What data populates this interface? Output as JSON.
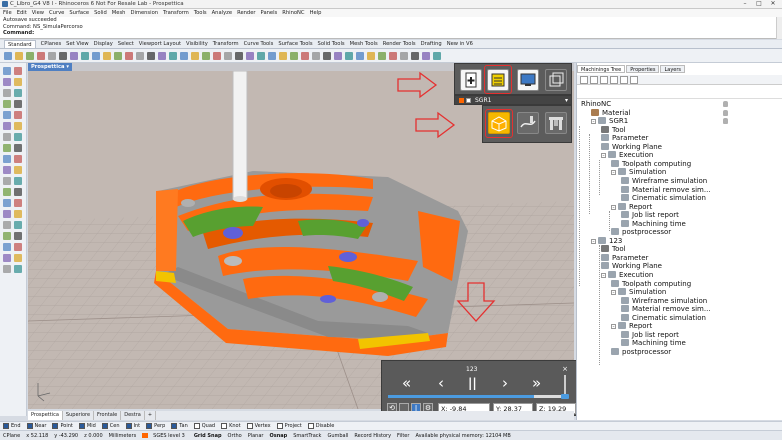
{
  "window": {
    "title": "C_Libro_G4 V8 l - Rhinoceros 6 Not For Resale Lab - Prospettica"
  },
  "menu": [
    "File",
    "Edit",
    "View",
    "Curve",
    "Surface",
    "Solid",
    "Mesh",
    "Dimension",
    "Transform",
    "Tools",
    "Analyze",
    "Render",
    "Panels",
    "RhinoNC",
    "Help"
  ],
  "command": {
    "lines": [
      "Autosave succeeded",
      "Command: NS_SimulaPercorso"
    ],
    "prompt": "Command:"
  },
  "toolbar_tabs": [
    "Standard",
    "CPlanes",
    "Set View",
    "Display",
    "Select",
    "Viewport Layout",
    "Visibility",
    "Transform",
    "Curve Tools",
    "Surface Tools",
    "Solid Tools",
    "Mesh Tools",
    "Render Tools",
    "Drafting",
    "New in V6"
  ],
  "viewport": {
    "title": "Prospettica",
    "tabs": [
      "Prospettica",
      "Superiore",
      "Frontale",
      "Destra",
      "+"
    ]
  },
  "plugin_panel": {
    "layer_name": "SGR1",
    "colors": {
      "orange": "#ff6600",
      "yellow": "#f0d000",
      "highlight": "#e53030"
    }
  },
  "player": {
    "step": "123",
    "close": "×",
    "controls": [
      "«",
      "‹",
      "||",
      "›",
      "»"
    ],
    "progress": 0.83,
    "coords": {
      "x": "X: -9.84",
      "y": "Y: 28.37",
      "z": "Z: 19.29"
    }
  },
  "right_panel": {
    "tabs": [
      "Machinings Tree",
      "Properties",
      "Layers"
    ],
    "tree": [
      {
        "label": "RhinoNC",
        "level": 0
      },
      {
        "label": "Material",
        "level": 1
      },
      {
        "label": "SGR1",
        "level": 1
      },
      {
        "label": "Tool",
        "level": 2
      },
      {
        "label": "Parameter",
        "level": 2
      },
      {
        "label": "Working Plane",
        "level": 2
      },
      {
        "label": "Execution",
        "level": 2
      },
      {
        "label": "Toolpath computing",
        "level": 3
      },
      {
        "label": "Simulation",
        "level": 3
      },
      {
        "label": "Wireframe simulation",
        "level": 4
      },
      {
        "label": "Material remove sim...",
        "level": 4
      },
      {
        "label": "Cinematic simulation",
        "level": 4
      },
      {
        "label": "Report",
        "level": 3
      },
      {
        "label": "Job list report",
        "level": 4
      },
      {
        "label": "Machining time",
        "level": 4
      },
      {
        "label": "postprocessor",
        "level": 3
      },
      {
        "label": "123",
        "level": 1
      },
      {
        "label": "Tool",
        "level": 2
      },
      {
        "label": "Parameter",
        "level": 2
      },
      {
        "label": "Working Plane",
        "level": 2
      },
      {
        "label": "Execution",
        "level": 2
      },
      {
        "label": "Toolpath computing",
        "level": 3
      },
      {
        "label": "Simulation",
        "level": 3
      },
      {
        "label": "Wireframe simulation",
        "level": 4
      },
      {
        "label": "Material remove sim...",
        "level": 4
      },
      {
        "label": "Cinematic simulation",
        "level": 4
      },
      {
        "label": "Report",
        "level": 3
      },
      {
        "label": "Job list report",
        "level": 4
      },
      {
        "label": "Machining time",
        "level": 4
      },
      {
        "label": "postprocessor",
        "level": 3
      }
    ]
  },
  "osnaps": [
    {
      "label": "End",
      "on": true
    },
    {
      "label": "Near",
      "on": true
    },
    {
      "label": "Point",
      "on": true
    },
    {
      "label": "Mid",
      "on": true
    },
    {
      "label": "Cen",
      "on": true
    },
    {
      "label": "Int",
      "on": true
    },
    {
      "label": "Perp",
      "on": true
    },
    {
      "label": "Tan",
      "on": true
    },
    {
      "label": "Quad",
      "on": false
    },
    {
      "label": "Knot",
      "on": false
    },
    {
      "label": "Vertex",
      "on": false
    },
    {
      "label": "Project",
      "on": false
    },
    {
      "label": "Disable",
      "on": false
    }
  ],
  "status": {
    "cplane": "CPlane",
    "x": "x 52.118",
    "y": "y -43.290",
    "z": "z 0.000",
    "units": "Millimeters",
    "layer": "SGES level 3",
    "toggles": [
      "Grid Snap",
      "Ortho",
      "Planar",
      "Osnap",
      "SmartTrack",
      "Gumball",
      "Record History",
      "Filter"
    ],
    "memory": "Available physical memory: 12104 MB"
  }
}
